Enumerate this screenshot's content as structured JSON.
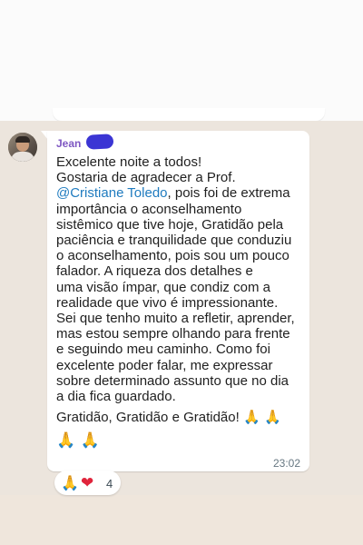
{
  "message": {
    "sender_name": "Jean",
    "lines": [
      {
        "text": "Excelente noite a todos!"
      },
      {
        "text": "Gostaria de agradecer a Prof."
      },
      {
        "mention": "@Cristiane Toledo",
        "text": ", pois foi de extrema"
      },
      {
        "text": "importância o aconselhamento"
      },
      {
        "text": "sistêmico que tive hoje, Gratidão pela"
      },
      {
        "text": "paciência e tranquilidade que conduziu"
      },
      {
        "text": "o aconselhamento, pois sou um pouco"
      },
      {
        "text": "falador. A riqueza dos detalhes e"
      },
      {
        "text": "uma visão ímpar, que condiz com a"
      },
      {
        "text": "realidade que vivo é impressionante."
      },
      {
        "text": "Sei que tenho muito a refletir, aprender,"
      },
      {
        "text": "mas estou sempre olhando para frente"
      },
      {
        "text": "e seguindo meu caminho. Como foi"
      },
      {
        "text": "excelente poder falar, me expressar"
      },
      {
        "text": "sobre determinado assunto que no dia"
      },
      {
        "text": "a dia fica guardado."
      }
    ],
    "closing": "Gratidão, Gratidão e Gratidão!",
    "closing_emojis": "🙏 🙏",
    "extra_emojis": "🙏 🙏",
    "time": "23:02"
  },
  "reactions": {
    "emojis": [
      "🙏",
      "❤"
    ],
    "count": "4"
  },
  "colors": {
    "sender": "#7e57c2",
    "mention": "#1f7bbf",
    "bubble": "#ffffff",
    "chat_background": "#ece5dd",
    "redaction": "#3b35d4"
  },
  "icons": {
    "avatar": "profile-photo",
    "reaction_1": "folded-hands-emoji",
    "reaction_2": "red-heart-emoji"
  }
}
